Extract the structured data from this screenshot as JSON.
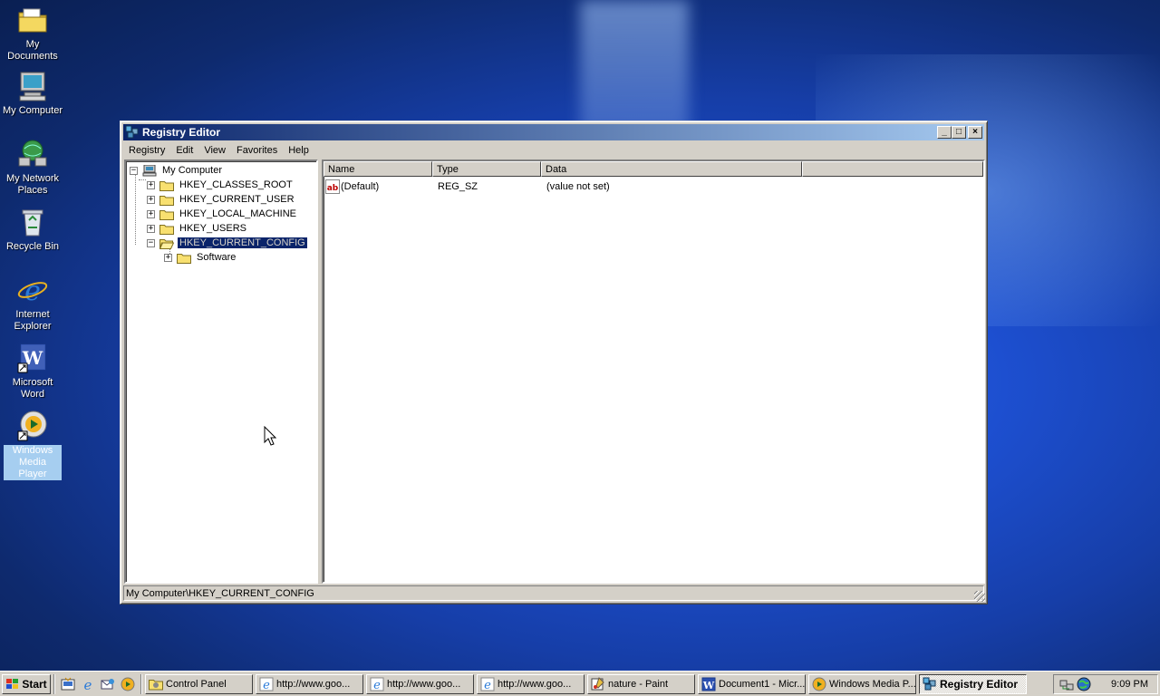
{
  "desktop": {
    "icons": [
      {
        "label": "My Documents",
        "icon": "folder-documents-icon"
      },
      {
        "label": "My Computer",
        "icon": "computer-icon"
      },
      {
        "label": "My Network Places",
        "icon": "network-icon"
      },
      {
        "label": "Recycle Bin",
        "icon": "recycle-bin-icon"
      },
      {
        "label": "Internet Explorer",
        "icon": "internet-explorer-icon"
      },
      {
        "label": "Microsoft Word",
        "icon": "word-icon"
      },
      {
        "label": "Windows Media Player",
        "icon": "media-player-icon"
      }
    ]
  },
  "window": {
    "title": "Registry Editor",
    "controls": {
      "minimize": "_",
      "maximize": "□",
      "close": "×"
    },
    "menu": [
      "Registry",
      "Edit",
      "View",
      "Favorites",
      "Help"
    ],
    "tree": {
      "root": "My Computer",
      "keys": [
        "HKEY_CLASSES_ROOT",
        "HKEY_CURRENT_USER",
        "HKEY_LOCAL_MACHINE",
        "HKEY_USERS",
        "HKEY_CURRENT_CONFIG"
      ],
      "selected_key": "HKEY_CURRENT_CONFIG",
      "children": [
        "Software"
      ],
      "expand_plus": "+",
      "expand_minus": "−"
    },
    "list": {
      "columns": [
        "Name",
        "Type",
        "Data"
      ],
      "rows": [
        {
          "name": "(Default)",
          "type": "REG_SZ",
          "data": "(value not set)"
        }
      ]
    },
    "status": "My Computer\\HKEY_CURRENT_CONFIG"
  },
  "taskbar": {
    "start_label": "Start",
    "tasks": [
      {
        "label": "Control Panel",
        "active": false
      },
      {
        "label": "http://www.goo...",
        "active": false
      },
      {
        "label": "http://www.goo...",
        "active": false
      },
      {
        "label": "http://www.goo...",
        "active": false
      },
      {
        "label": "nature - Paint",
        "active": false
      },
      {
        "label": "Document1 - Micr...",
        "active": false
      },
      {
        "label": "Windows Media P...",
        "active": false
      },
      {
        "label": "Registry Editor",
        "active": true
      }
    ],
    "clock": "9:09 PM"
  },
  "colors": {
    "titlebar_start": "#0a246a",
    "titlebar_end": "#a6caf0",
    "selection": "#0a246a",
    "face": "#d4d0c8"
  }
}
